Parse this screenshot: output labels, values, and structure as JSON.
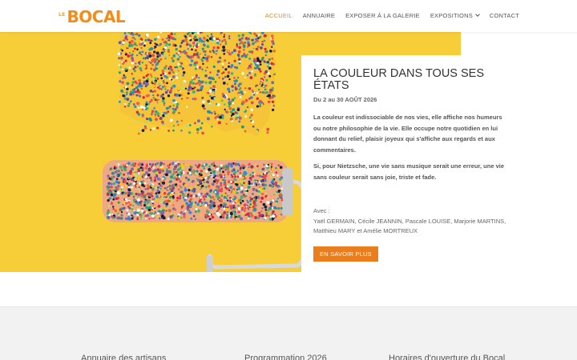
{
  "brand": {
    "le": "LE",
    "name": "BOCAL",
    "color": "#f28d1a"
  },
  "nav": {
    "items": [
      {
        "label": "ACCUEIL",
        "active": true
      },
      {
        "label": "ANNUAIRE",
        "active": false
      },
      {
        "label": "EXPOSER À LA GALERIE",
        "active": false
      },
      {
        "label": "EXPOSITIONS",
        "active": false,
        "dropdown": true
      },
      {
        "label": "CONTACT",
        "active": false
      }
    ],
    "accent": "#e8891b"
  },
  "hero": {
    "image": "colorful-beads-paint-roller",
    "background": "#f6cb2f"
  },
  "exhibition": {
    "title": "LA COULEUR DANS TOUS SES ÉTATS",
    "dates": "Du 2 au 30 AOÛT 2026",
    "paragraph_1": "La couleur est indissociable de nos vies, elle affiche nos humeurs ou notre philosophie de la vie. Elle occupe notre quotidien en lui donnant du relief, plaisir joyeux qui s'affiche aux regards et aux commentaires.",
    "paragraph_2": "Si, pour Nietzsche, une vie sans musique serait une erreur, une vie sans couleur serait sans joie, triste et fade.",
    "with_label": "Avec :",
    "artists": "Yaël GERMAIN, Cécile JEANNIN, Pascale LOUISE, Marjorie MARTINS, Matthieu MARY et Amélie MORTREUX",
    "button_label": "EN SAVOIR PLUS",
    "button_color": "#ea7d1d"
  },
  "footer": {
    "columns": [
      "Annuaire des artisans",
      "Programmation 2026",
      "Horaires d'ouverture du Bocal"
    ],
    "background": "#f2f2f2"
  }
}
